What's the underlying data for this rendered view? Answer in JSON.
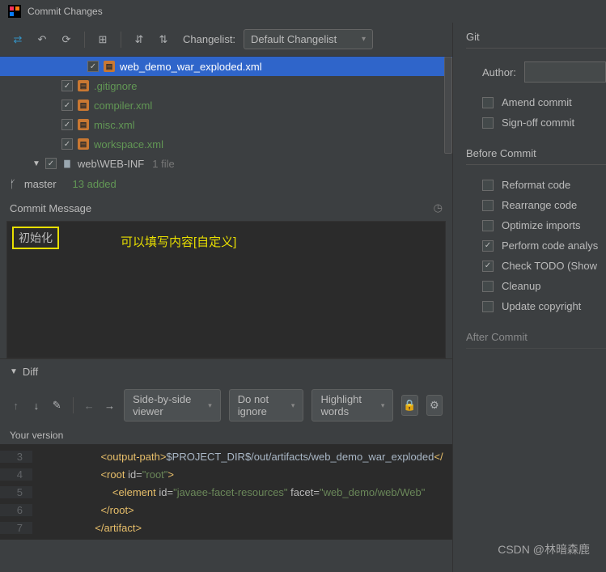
{
  "title": "Commit Changes",
  "toolbar": {
    "changelist_label": "Changelist:",
    "changelist_value": "Default Changelist"
  },
  "tree": {
    "files": [
      {
        "name": "web_demo_war_exploded.xml",
        "selected": true,
        "indent": 2
      },
      {
        "name": ".gitignore",
        "selected": false,
        "indent": 1
      },
      {
        "name": "compiler.xml",
        "selected": false,
        "indent": 1
      },
      {
        "name": "misc.xml",
        "selected": false,
        "indent": 1
      },
      {
        "name": "workspace.xml",
        "selected": false,
        "indent": 1
      }
    ],
    "folder": {
      "name": "web\\WEB-INF",
      "count": "1 file"
    }
  },
  "branch": {
    "name": "master",
    "added": "13 added"
  },
  "commit_msg": {
    "header": "Commit Message",
    "value": "初始化",
    "annotation": "可以填写内容[自定义]"
  },
  "diff": {
    "label": "Diff",
    "viewer": "Side-by-side viewer",
    "ignore": "Do not ignore",
    "highlight": "Highlight words",
    "version": "Your version",
    "lines": [
      {
        "n": "3",
        "html": "<span class='tag'>&lt;output-path&gt;</span><span class='txt'>$PROJECT_DIR$/out/artifacts/web_demo_war_exploded</span><span class='tag'>&lt;/</span>"
      },
      {
        "n": "4",
        "html": "<span class='tag'>&lt;root </span><span class='attr'>id=</span><span class='str'>\"root\"</span><span class='tag'>&gt;</span>"
      },
      {
        "n": "5",
        "html": "  <span class='tag'>&lt;element </span><span class='attr'>id=</span><span class='str'>\"javaee-facet-resources\"</span> <span class='attr'>facet=</span><span class='str'>\"web_demo/web/Web\"</span>"
      },
      {
        "n": "6",
        "html": "<span class='tag'>&lt;/root&gt;</span>"
      },
      {
        "n": "7",
        "html": "<span class='tag'>&lt;/artifact&gt;</span>"
      }
    ],
    "indents": [
      2,
      2,
      3,
      2,
      1
    ]
  },
  "right": {
    "git": "Git",
    "author_label": "Author:",
    "amend": "Amend commit",
    "signoff": "Sign-off commit",
    "before": "Before Commit",
    "reformat": "Reformat code",
    "rearrange": "Rearrange code",
    "optimize": "Optimize imports",
    "analysis": "Perform code analys",
    "todo": "Check TODO (Show ",
    "cleanup": "Cleanup",
    "copyright": "Update copyright",
    "after": "After Commit"
  },
  "watermark": "CSDN @林暗森鹿"
}
